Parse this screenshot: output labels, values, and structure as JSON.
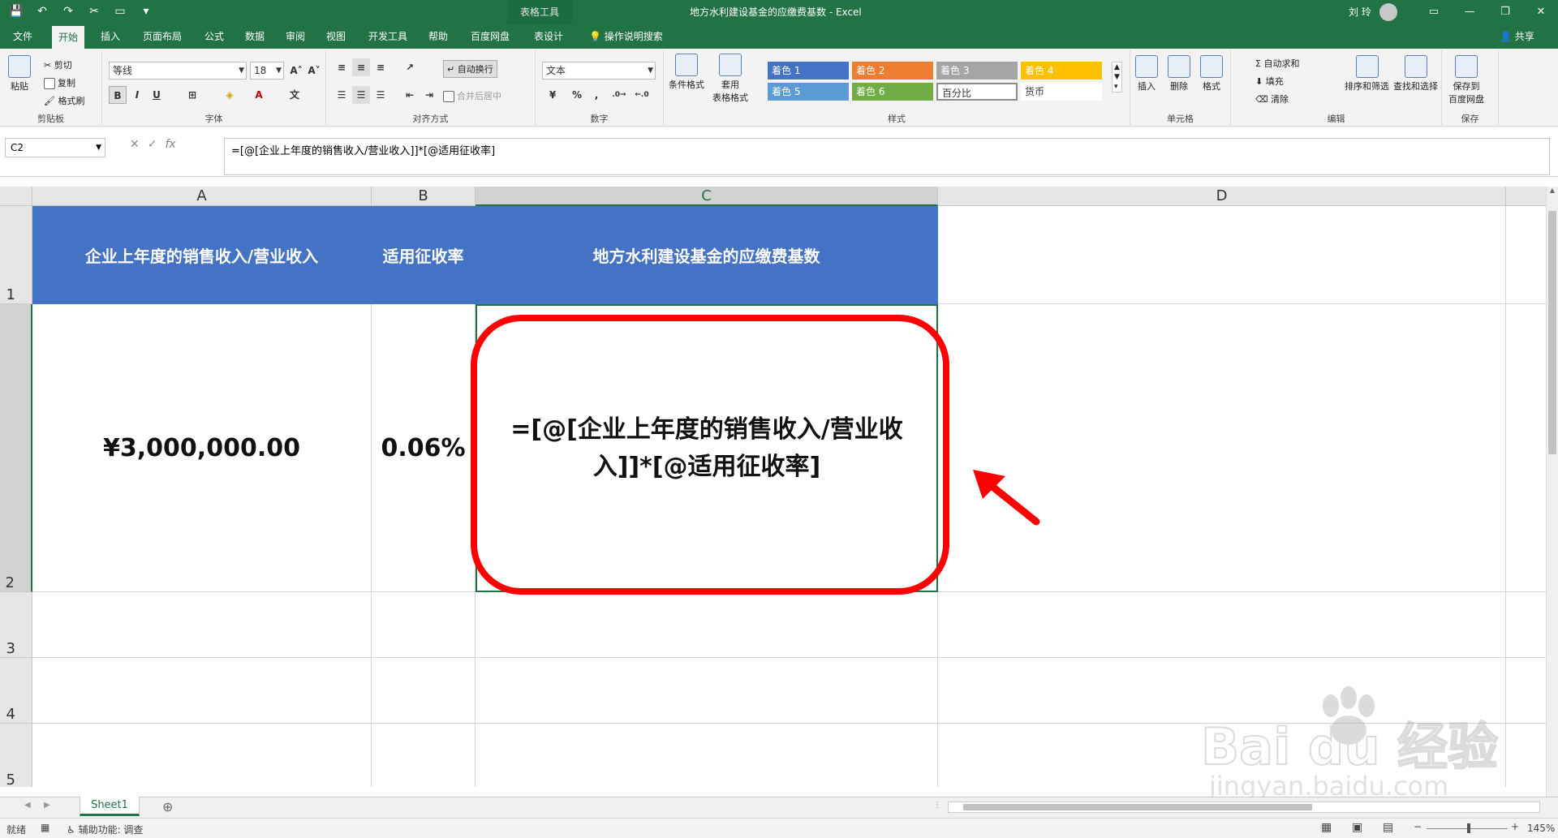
{
  "titlebar": {
    "context_tools": "表格工具",
    "window_title": "地方水利建设基金的应缴费基数  -  Excel",
    "user_name": "刘 玲"
  },
  "tabs": [
    {
      "label": "文件"
    },
    {
      "label": "开始"
    },
    {
      "label": "插入"
    },
    {
      "label": "页面布局"
    },
    {
      "label": "公式"
    },
    {
      "label": "数据"
    },
    {
      "label": "审阅"
    },
    {
      "label": "视图"
    },
    {
      "label": "开发工具"
    },
    {
      "label": "帮助"
    },
    {
      "label": "百度网盘"
    },
    {
      "label": "表设计"
    },
    {
      "label": "操作说明搜索"
    }
  ],
  "share_label": "共享",
  "ribbon": {
    "clipboard": {
      "paste": "粘贴",
      "cut": "剪切",
      "copy": "复制",
      "painter": "格式刷",
      "label": "剪贴板"
    },
    "font": {
      "name": "等线",
      "size": "18",
      "bold": "B",
      "italic": "I",
      "underline": "U",
      "label": "字体"
    },
    "align": {
      "wrap": "自动换行",
      "merge": "合并后居中",
      "label": "对齐方式"
    },
    "number": {
      "format": "文本",
      "percent": "%",
      "comma": ",",
      "label": "数字"
    },
    "styles": {
      "cond": "条件格式",
      "table_fmt1": "套用",
      "table_fmt2": "表格格式",
      "items": [
        {
          "label": "着色 1",
          "color": "#4472c4"
        },
        {
          "label": "着色 2",
          "color": "#ed7d31"
        },
        {
          "label": "着色 3",
          "color": "#a5a5a5"
        },
        {
          "label": "着色 4",
          "color": "#ffc000"
        },
        {
          "label": "着色 5",
          "color": "#5b9bd5"
        },
        {
          "label": "着色 6",
          "color": "#70ad47"
        },
        {
          "label": "百分比",
          "color": "#ffffff"
        },
        {
          "label": "货币",
          "color": "#ffffff"
        }
      ],
      "label": "样式"
    },
    "cells": {
      "insert": "插入",
      "delete": "删除",
      "format": "格式",
      "label": "单元格"
    },
    "editing": {
      "autosum": "自动求和",
      "fill": "填充",
      "clear": "清除",
      "sort": "排序和筛选",
      "find": "查找和选择",
      "label": "编辑"
    },
    "save": {
      "line1": "保存到",
      "line2": "百度网盘",
      "label": "保存"
    }
  },
  "formula_bar": {
    "name_box": "C2",
    "cancel": "✕",
    "enter": "✓",
    "fx": "fx",
    "formula": "=[@[企业上年度的销售收入/营业收入]]*[@适用征收率]"
  },
  "grid": {
    "columns": [
      "A",
      "B",
      "C",
      "D"
    ],
    "rows": [
      "1",
      "2",
      "3",
      "4",
      "5"
    ],
    "header_row": [
      "企业上年度的销售收入/营业收入",
      "适用征收率",
      "地方水利建设基金的应缴费基数"
    ],
    "data_row": [
      "¥3,000,000.00",
      "0.06%",
      "=[@[企业上年度的销售收入/营业收入]]*[@适用征收率]"
    ],
    "header_color": "#4472c4",
    "annotation_color": "#ff0000"
  },
  "sheets": [
    {
      "label": "Sheet1"
    }
  ],
  "status": {
    "ready": "就绪",
    "accessibility": "辅助功能: 调查",
    "zoom": "145%"
  },
  "watermark": {
    "brand": "Bai du 经验",
    "url": "jingyan.baidu.com"
  }
}
